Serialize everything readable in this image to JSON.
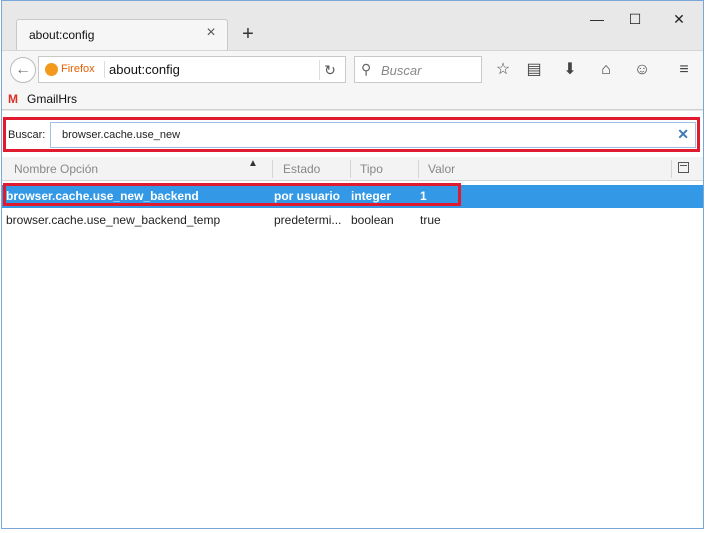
{
  "tab": {
    "title": "about:config"
  },
  "window_controls": {
    "minimize": "—",
    "maximize": "☐",
    "close": "✕"
  },
  "navbar": {
    "identity_label": "Firefox",
    "url": "about:config",
    "search_placeholder": "Buscar"
  },
  "bookmarks": [
    {
      "icon": "M",
      "label": "GmailHrs"
    }
  ],
  "filter": {
    "label": "Buscar:",
    "value": "browser.cache.use_new"
  },
  "columns": [
    "Nombre Opción",
    "Estado",
    "Tipo",
    "Valor"
  ],
  "rows": [
    {
      "name": "browser.cache.use_new_backend",
      "status": "por usuario",
      "type": "integer",
      "value": "1"
    },
    {
      "name": "browser.cache.use_new_backend_temp",
      "status": "predetermi...",
      "type": "boolean",
      "value": "true"
    }
  ],
  "colors": {
    "selection": "#3399e6",
    "annotation": "#e01b2f"
  }
}
